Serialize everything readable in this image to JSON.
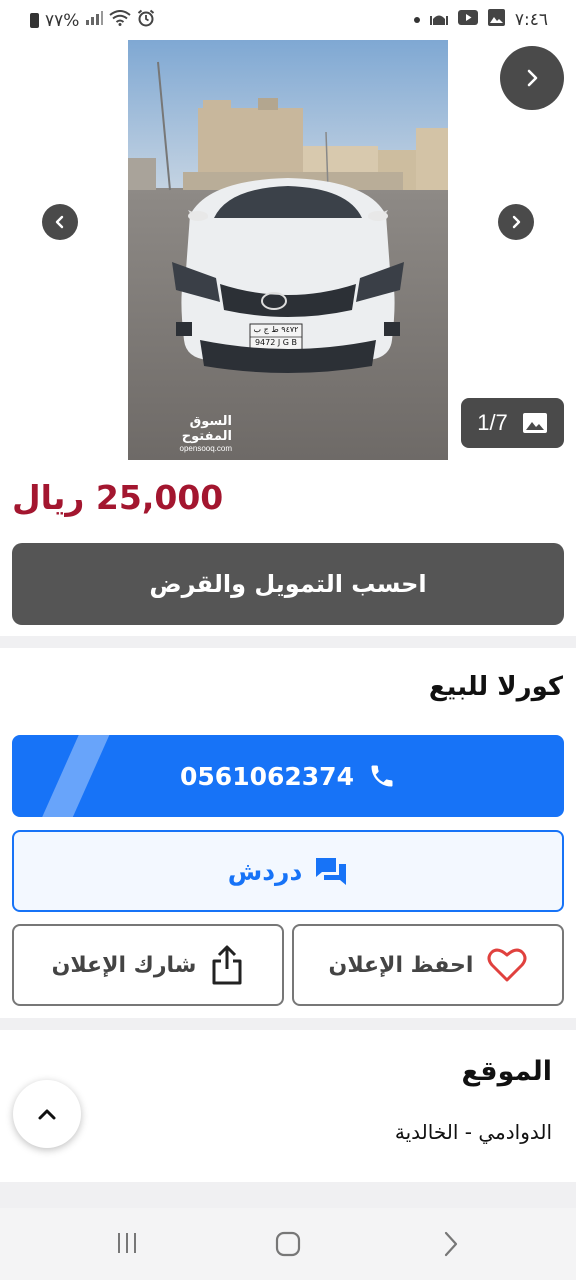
{
  "status_bar": {
    "time": "٧:٤٦",
    "battery": "٧٧%",
    "icons": [
      "battery-icon",
      "signal-icon",
      "wifi-icon",
      "alarm-icon",
      "notification-dot-icon",
      "mosque-icon",
      "youtube-icon",
      "gallery-icon"
    ]
  },
  "gallery": {
    "counter": "1/7",
    "watermark_ar": "السوق المفتوح",
    "watermark_en": "opensooq.com",
    "plate_top": "٩٤٧٢ ط ج ب",
    "plate_bottom": "9472 J G B"
  },
  "listing": {
    "price": "25,000 ريال",
    "finance_label": "احسب التمويل والقرض",
    "title": "كورلا للبيع"
  },
  "actions": {
    "phone": "0561062374",
    "chat_label": "دردش",
    "save_label": "احفظ الإعلان",
    "share_label": "شارك الإعلان"
  },
  "location": {
    "heading": "الموقع",
    "value": "الدوادمي - الخالدية"
  },
  "colors": {
    "primary_blue": "#1773f7",
    "price_red": "#a3162f",
    "heart_red": "#e0413e"
  }
}
